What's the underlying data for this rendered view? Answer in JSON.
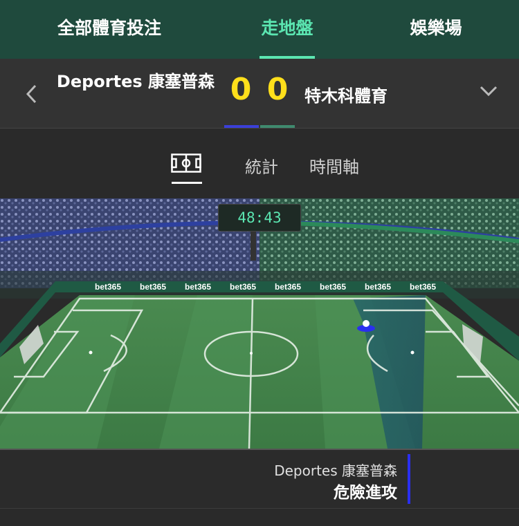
{
  "nav": {
    "tabs": [
      {
        "label": "全部體育投注"
      },
      {
        "label": "走地盤"
      },
      {
        "label": "娛樂場"
      }
    ],
    "active_index": 1,
    "accent": "#5be6b1"
  },
  "match": {
    "home_name": "Deportes 康塞普森",
    "away_name": "特木科體育",
    "home_score": "0",
    "away_score": "0",
    "home_color": "#3b3fd8",
    "away_color": "#3f8a6e"
  },
  "subtabs": {
    "pitch_icon": "pitch-icon",
    "stats_label": "統計",
    "timeline_label": "時間軸"
  },
  "field": {
    "clock": "48:43",
    "board_text": "bet365",
    "ball": "ball-icon"
  },
  "event": {
    "team": "Deportes 康塞普森",
    "action": "危險進攻",
    "color": "#2a2ff0"
  }
}
